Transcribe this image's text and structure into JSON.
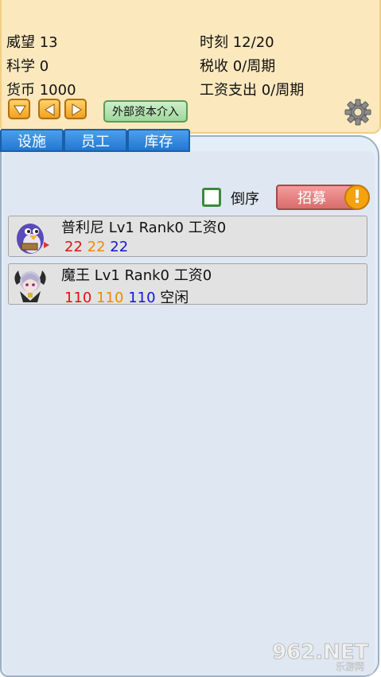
{
  "stats": {
    "prestige": "威望 13",
    "science": "科学 0",
    "currency": "货币 1000",
    "time": "时刻 12/20",
    "tax": "税收 0/周期",
    "wage_expense": "工资支出 0/周期"
  },
  "controls": {
    "external_capital": "外部资本介入"
  },
  "tabs": [
    {
      "label": "设施"
    },
    {
      "label": "员工"
    },
    {
      "label": "库存"
    }
  ],
  "list_controls": {
    "sort_label": "倒序",
    "recruit_label": "招募",
    "alert_glyph": "!"
  },
  "staff": [
    {
      "name": "普利尼 Lv1 Rank0 工资0",
      "stat1": "22",
      "stat2": "22",
      "stat3": "22",
      "status": ""
    },
    {
      "name": "魔王 Lv1 Rank0 工资0",
      "stat1": "110",
      "stat2": "110",
      "stat3": "110",
      "status": "空闲"
    }
  ],
  "watermark": {
    "brand": "962.NET",
    "sub": "乐游网"
  },
  "colors": {
    "stat_red": "#e01010",
    "stat_orange": "#f08a00",
    "stat_blue": "#1515d8",
    "tab_blue": "#2178d2",
    "panel_cream": "#fbe8bd"
  }
}
